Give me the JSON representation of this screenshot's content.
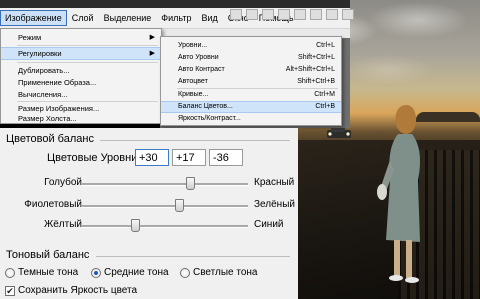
{
  "menubar": {
    "items": [
      "Изображение",
      "Слой",
      "Выделение",
      "Фильтр",
      "Вид",
      "Окно",
      "Помощь"
    ]
  },
  "image_menu": {
    "items": [
      {
        "label": "Режим",
        "has_submenu": true
      },
      {
        "label": "Регулировки",
        "has_submenu": true
      },
      {
        "label": "Дублировать..."
      },
      {
        "label": "Применение Образа..."
      },
      {
        "label": "Вычисления..."
      },
      {
        "label": "Размер Изображения..."
      },
      {
        "label": "Размер Холста..."
      }
    ]
  },
  "adjust_menu": {
    "items": [
      {
        "label": "Уровни...",
        "shortcut": "Ctrl+L"
      },
      {
        "label": "Авто Уровни",
        "shortcut": "Shift+Ctrl+L"
      },
      {
        "label": "Авто Контраст",
        "shortcut": "Alt+Shift+Ctrl+L"
      },
      {
        "label": "Автоцвет",
        "shortcut": "Shift+Ctrl+B"
      },
      {
        "label": "Кривые...",
        "shortcut": "Ctrl+M"
      },
      {
        "label": "Баланс Цветов...",
        "shortcut": "Ctrl+B"
      },
      {
        "label": "Яркость/Контраст...",
        "shortcut": ""
      }
    ]
  },
  "color_balance": {
    "group_title": "Цветовой баланс",
    "levels_label": "Цветовые Уровни:",
    "levels": [
      "+30",
      "+17",
      "-36"
    ],
    "sliders": [
      {
        "left": "Голубой",
        "right": "Красный",
        "value": 30
      },
      {
        "left": "Фиолетовый",
        "right": "Зелёный",
        "value": 17
      },
      {
        "left": "Жёлтый",
        "right": "Синий",
        "value": -36
      }
    ],
    "tone_title": "Тоновый баланс",
    "tones": [
      {
        "label": "Темные тона",
        "selected": false
      },
      {
        "label": "Средние тона",
        "selected": true
      },
      {
        "label": "Светлые тона",
        "selected": false
      }
    ],
    "preserve_label": "Сохранить Яркость цвета",
    "preserve_checked": true
  },
  "colors": {
    "highlight": "#cfe3f9",
    "dialog_bg": "#f0f0f0",
    "radio_dot": "#1f57b8"
  }
}
